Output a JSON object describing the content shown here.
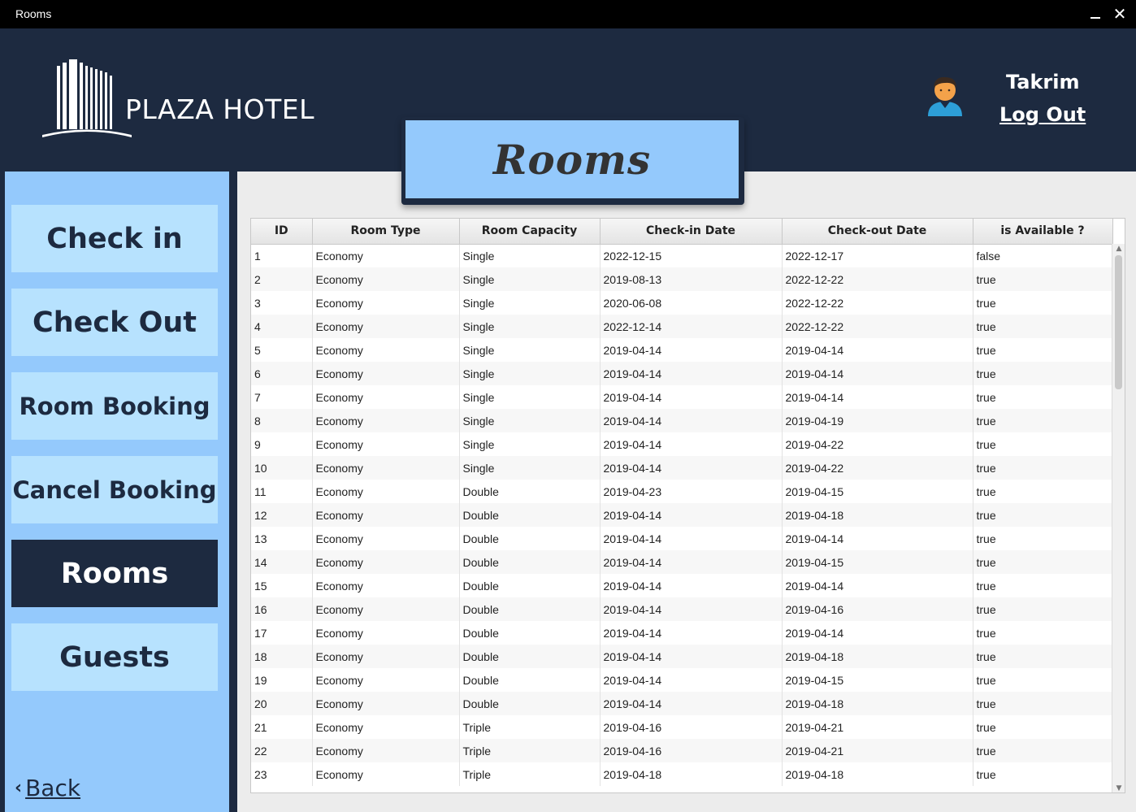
{
  "window": {
    "title": "Rooms"
  },
  "header": {
    "brand": "PLAZA HOTEL",
    "username": "Takrim",
    "logout_label": "Log Out"
  },
  "banner": {
    "title": "Rooms"
  },
  "sidebar": {
    "items": [
      {
        "label": "Check in",
        "active": false
      },
      {
        "label": "Check Out",
        "active": false
      },
      {
        "label": "Room Booking",
        "active": false
      },
      {
        "label": "Cancel Booking",
        "active": false
      },
      {
        "label": "Rooms",
        "active": true
      },
      {
        "label": "Guests",
        "active": false
      }
    ],
    "back_label": "Back"
  },
  "table": {
    "columns": [
      "ID",
      "Room Type",
      "Room Capacity",
      "Check-in Date",
      "Check-out Date",
      "is Available ?"
    ],
    "rows": [
      [
        "1",
        "Economy",
        "Single",
        "2022-12-15",
        "2022-12-17",
        "false"
      ],
      [
        "2",
        "Economy",
        "Single",
        "2019-08-13",
        "2022-12-22",
        "true"
      ],
      [
        "3",
        "Economy",
        "Single",
        "2020-06-08",
        "2022-12-22",
        "true"
      ],
      [
        "4",
        "Economy",
        "Single",
        "2022-12-14",
        "2022-12-22",
        "true"
      ],
      [
        "5",
        "Economy",
        "Single",
        "2019-04-14",
        "2019-04-14",
        "true"
      ],
      [
        "6",
        "Economy",
        "Single",
        "2019-04-14",
        "2019-04-14",
        "true"
      ],
      [
        "7",
        "Economy",
        "Single",
        "2019-04-14",
        "2019-04-14",
        "true"
      ],
      [
        "8",
        "Economy",
        "Single",
        "2019-04-14",
        "2019-04-19",
        "true"
      ],
      [
        "9",
        "Economy",
        "Single",
        "2019-04-14",
        "2019-04-22",
        "true"
      ],
      [
        "10",
        "Economy",
        "Single",
        "2019-04-14",
        "2019-04-22",
        "true"
      ],
      [
        "11",
        "Economy",
        "Double",
        "2019-04-23",
        "2019-04-15",
        "true"
      ],
      [
        "12",
        "Economy",
        "Double",
        "2019-04-14",
        "2019-04-18",
        "true"
      ],
      [
        "13",
        "Economy",
        "Double",
        "2019-04-14",
        "2019-04-14",
        "true"
      ],
      [
        "14",
        "Economy",
        "Double",
        "2019-04-14",
        "2019-04-15",
        "true"
      ],
      [
        "15",
        "Economy",
        "Double",
        "2019-04-14",
        "2019-04-14",
        "true"
      ],
      [
        "16",
        "Economy",
        "Double",
        "2019-04-14",
        "2019-04-16",
        "true"
      ],
      [
        "17",
        "Economy",
        "Double",
        "2019-04-14",
        "2019-04-14",
        "true"
      ],
      [
        "18",
        "Economy",
        "Double",
        "2019-04-14",
        "2019-04-18",
        "true"
      ],
      [
        "19",
        "Economy",
        "Double",
        "2019-04-14",
        "2019-04-15",
        "true"
      ],
      [
        "20",
        "Economy",
        "Double",
        "2019-04-14",
        "2019-04-18",
        "true"
      ],
      [
        "21",
        "Economy",
        "Triple",
        "2019-04-16",
        "2019-04-21",
        "true"
      ],
      [
        "22",
        "Economy",
        "Triple",
        "2019-04-16",
        "2019-04-21",
        "true"
      ],
      [
        "23",
        "Economy",
        "Triple",
        "2019-04-18",
        "2019-04-18",
        "true"
      ]
    ]
  },
  "colors": {
    "navy": "#1d2a40",
    "sidebar_blue": "#94c9fc",
    "button_blue": "#b7e2fe"
  },
  "icons": {
    "logo": "hotel-building-icon",
    "avatar": "user-avatar-icon",
    "back": "chevron-left-icon"
  }
}
